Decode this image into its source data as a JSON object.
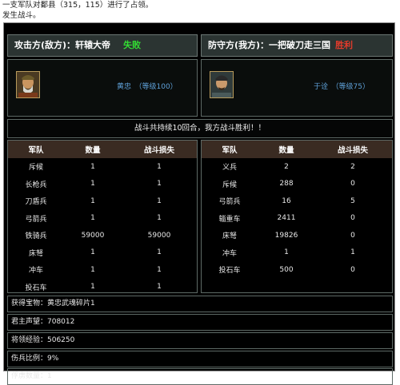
{
  "messages": [
    "一支军队对鄱县（315，115）进行了占领。",
    "发生战斗。"
  ],
  "attacker": {
    "header": "攻击方(敌方)：轩辕大帝",
    "result": "失败",
    "general": "黄忠　（等级100）",
    "table": {
      "columns": [
        "军队",
        "数量",
        "战斗损失"
      ],
      "rows": [
        [
          "斥候",
          "1",
          "1"
        ],
        [
          "长枪兵",
          "1",
          "1"
        ],
        [
          "刀盾兵",
          "1",
          "1"
        ],
        [
          "弓箭兵",
          "1",
          "1"
        ],
        [
          "铁骑兵",
          "59000",
          "59000"
        ],
        [
          "床弩",
          "1",
          "1"
        ],
        [
          "冲车",
          "1",
          "1"
        ],
        [
          "投石车",
          "1",
          "1"
        ]
      ]
    }
  },
  "defender": {
    "header": "防守方(我方)：一把破刀走三国",
    "result": "胜利",
    "general": "于诠　（等级75）",
    "table": {
      "columns": [
        "军队",
        "数量",
        "战斗损失"
      ],
      "rows": [
        [
          "义兵",
          "2",
          "2"
        ],
        [
          "斥候",
          "288",
          "0"
        ],
        [
          "弓箭兵",
          "16",
          "5"
        ],
        [
          "辎重车",
          "2411",
          "0"
        ],
        [
          "床弩",
          "19826",
          "0"
        ],
        [
          "冲车",
          "1",
          "1"
        ],
        [
          "投石车",
          "500",
          "0"
        ]
      ]
    }
  },
  "summary": "战斗共持续10回合，我方战斗胜利！！",
  "info": [
    "获得宝物：黄忠武魂碎片1",
    "君主声望：708012",
    "将领经验：506250",
    "伤兵比例：9%",
    "俘虏数量：1"
  ]
}
